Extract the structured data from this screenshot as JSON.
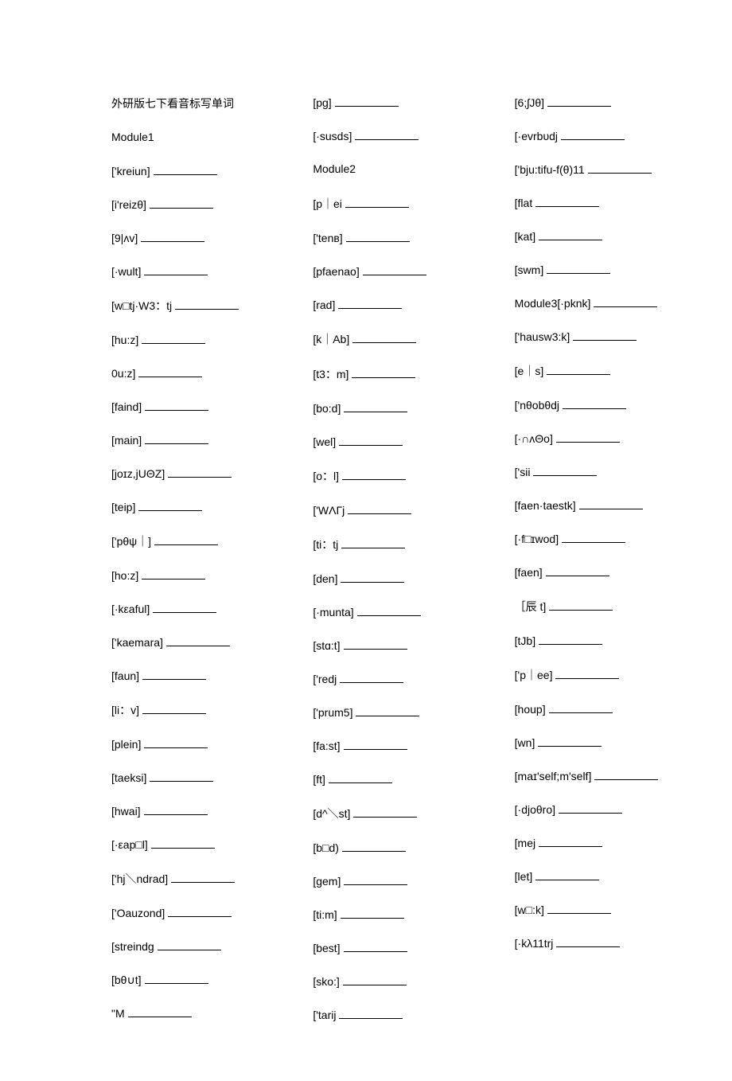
{
  "title": "外研版七下看音标写单词",
  "columns": [
    [
      {
        "text": "外研版七下看音标写单词",
        "blank": false
      },
      {
        "text": "Module1",
        "blank": false
      },
      {
        "text": "['kreiun]",
        "blank": true
      },
      {
        "text": "[i'reizθ]",
        "blank": true
      },
      {
        "text": "[9|ʌv]",
        "blank": true
      },
      {
        "text": "[·wult]",
        "blank": true
      },
      {
        "text": "[w□tj·W3：tj",
        "blank": true
      },
      {
        "text": "[hu:z]",
        "blank": true
      },
      {
        "text": "0u:z]",
        "blank": true
      },
      {
        "text": "[faind]",
        "blank": true
      },
      {
        "text": "[main]",
        "blank": true
      },
      {
        "text": "[joɪz,jUΘZ]",
        "blank": true
      },
      {
        "text": "[teip]",
        "blank": true
      },
      {
        "text": "['pθψ｜]",
        "blank": true
      },
      {
        "text": "[ho:z]",
        "blank": true
      },
      {
        "text": "[·kεaful]",
        "blank": true
      },
      {
        "text": "['kaemara]",
        "blank": true
      },
      {
        "text": "[faun]",
        "blank": true
      },
      {
        "text": "[li：v]",
        "blank": true
      },
      {
        "text": "[plein]",
        "blank": true
      },
      {
        "text": "[taeksi]",
        "blank": true
      },
      {
        "text": "[hwai]",
        "blank": true
      },
      {
        "text": "[·εap□l]",
        "blank": true
      },
      {
        "text": "['hj＼ndrad]",
        "blank": true
      },
      {
        "text": "['Oauzond]",
        "blank": true
      },
      {
        "text": "[streindg",
        "blank": true
      },
      {
        "text": "[bθ∪t]",
        "blank": true
      },
      {
        "text": "\"M",
        "blank": true
      }
    ],
    [
      {
        "text": "[pg]",
        "blank": true
      },
      {
        "text": "[·susds]",
        "blank": true
      },
      {
        "text": "Module2",
        "blank": false
      },
      {
        "text": "[p｜ei",
        "blank": true
      },
      {
        "text": "['tenв]",
        "blank": true
      },
      {
        "text": "[pfaenao]",
        "blank": true
      },
      {
        "text": "[rad]",
        "blank": true
      },
      {
        "text": "[k｜Ab]",
        "blank": true
      },
      {
        "text": "[t3：m]",
        "blank": true
      },
      {
        "text": "[bo:d]",
        "blank": true
      },
      {
        "text": "[wel]",
        "blank": true
      },
      {
        "text": "[o：l]",
        "blank": true
      },
      {
        "text": "['WΛΓj",
        "blank": true
      },
      {
        "text": "[ti：tj",
        "blank": true
      },
      {
        "text": "[den]",
        "blank": true
      },
      {
        "text": "[·munta]",
        "blank": true
      },
      {
        "text": "[stɑ:t]",
        "blank": true
      },
      {
        "text": "['redj",
        "blank": true
      },
      {
        "text": "['prum5]",
        "blank": true
      },
      {
        "text": "[fa:st]",
        "blank": true
      },
      {
        "text": "[ft]",
        "blank": true
      },
      {
        "text": "[d^＼st]",
        "blank": true
      },
      {
        "text": "[b□d)",
        "blank": true
      },
      {
        "text": "[gem]",
        "blank": true
      },
      {
        "text": "[ti:m]",
        "blank": true
      },
      {
        "text": "[best]",
        "blank": true
      },
      {
        "text": "[sko:]",
        "blank": true
      },
      {
        "text": "['tarij",
        "blank": true
      }
    ],
    [
      {
        "text": "[6;ʃJθ]",
        "blank": true
      },
      {
        "text": "[·evrbυdj",
        "blank": true
      },
      {
        "text": "['bju:tifu-f(θ)11",
        "blank": true
      },
      {
        "text": "[flat",
        "blank": true
      },
      {
        "text": "[kat]",
        "blank": true
      },
      {
        "text": "[swm]",
        "blank": true
      },
      {
        "text": "Module3[·pknk]",
        "blank": true
      },
      {
        "text": "['hausw3:k]",
        "blank": true
      },
      {
        "text": "[e｜s]",
        "blank": true
      },
      {
        "text": "['nθobθdj",
        "blank": true
      },
      {
        "text": "[·∩ʌΘo]",
        "blank": true
      },
      {
        "text": "['sii",
        "blank": true
      },
      {
        "text": "[faen·taestk]",
        "blank": true
      },
      {
        "text": "[·f□ɪwod]",
        "blank": true
      },
      {
        "text": "[faen]",
        "blank": true
      },
      {
        "text": "［辰 t]",
        "blank": true
      },
      {
        "text": "[tJb]",
        "blank": true
      },
      {
        "text": "['p｜ee]",
        "blank": true
      },
      {
        "text": "[houp]",
        "blank": true
      },
      {
        "text": "[wn]",
        "blank": true
      },
      {
        "text": "[maɪ'self;m'self]",
        "blank": true
      },
      {
        "text": "[·djoθro]",
        "blank": true
      },
      {
        "text": "[mej",
        "blank": true
      },
      {
        "text": "[let]",
        "blank": true
      },
      {
        "text": "[w□:k]",
        "blank": true
      },
      {
        "text": "[·kλ11trj",
        "blank": true
      }
    ]
  ]
}
